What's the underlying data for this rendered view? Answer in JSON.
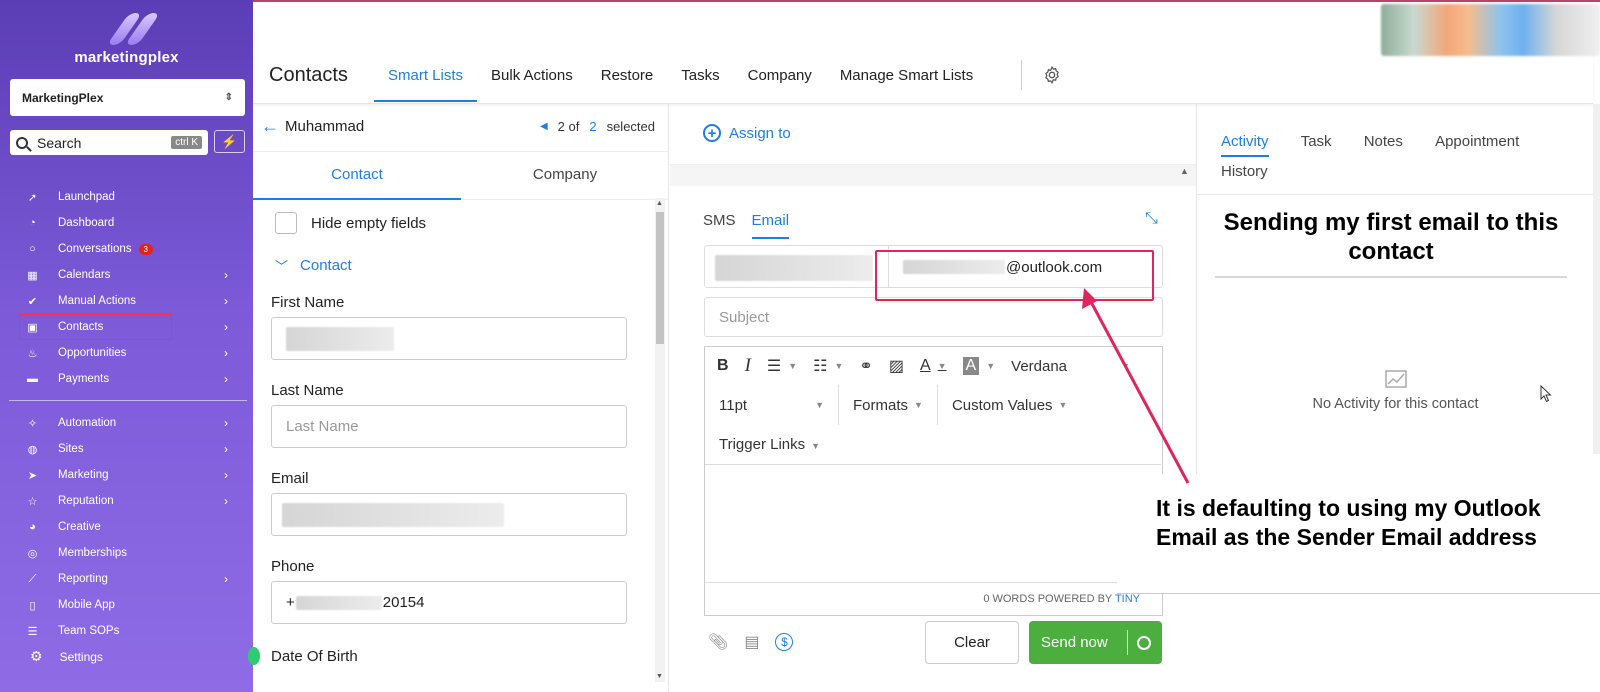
{
  "sidebar": {
    "brand": "marketingplex",
    "account": "MarketingPlex",
    "search_label": "Search",
    "search_shortcut": "ctrl K",
    "items": [
      {
        "label": "Launchpad",
        "icon": "rocket-icon",
        "has_arrow": false
      },
      {
        "label": "Dashboard",
        "icon": "gauge-icon",
        "has_arrow": false
      },
      {
        "label": "Conversations",
        "icon": "chat-icon",
        "has_arrow": false,
        "badge": "3"
      },
      {
        "label": "Calendars",
        "icon": "calendar-icon",
        "has_arrow": true
      },
      {
        "label": "Manual Actions",
        "icon": "check-icon",
        "has_arrow": true
      },
      {
        "label": "Contacts",
        "icon": "contact-card-icon",
        "has_arrow": true,
        "highlighted": true
      },
      {
        "label": "Opportunities",
        "icon": "flame-icon",
        "has_arrow": true
      },
      {
        "label": "Payments",
        "icon": "card-icon",
        "has_arrow": true
      }
    ],
    "items2": [
      {
        "label": "Automation",
        "icon": "wand-icon",
        "has_arrow": true
      },
      {
        "label": "Sites",
        "icon": "globe-icon",
        "has_arrow": true
      },
      {
        "label": "Marketing",
        "icon": "send-icon",
        "has_arrow": true
      },
      {
        "label": "Reputation",
        "icon": "star-icon",
        "has_arrow": true
      },
      {
        "label": "Creative",
        "icon": "palette-icon",
        "has_arrow": false
      },
      {
        "label": "Memberships",
        "icon": "badge-icon",
        "has_arrow": false
      },
      {
        "label": "Reporting",
        "icon": "chart-icon",
        "has_arrow": true
      },
      {
        "label": "Mobile App",
        "icon": "phone-icon",
        "has_arrow": false
      },
      {
        "label": "Team SOPs",
        "icon": "list-icon",
        "has_arrow": false
      }
    ],
    "settings": "Settings"
  },
  "header": {
    "title": "Contacts",
    "tabs": [
      "Smart Lists",
      "Bulk Actions",
      "Restore",
      "Tasks",
      "Company",
      "Manage Smart Lists"
    ]
  },
  "contact_panel": {
    "name": "Muhammad",
    "pager_current": "2 of",
    "pager_total": "2",
    "pager_suffix": "selected",
    "tabs": [
      "Contact",
      "Company"
    ],
    "hide_empty": "Hide empty fields",
    "section": "Contact",
    "first_name_label": "First Name",
    "last_name_label": "Last Name",
    "last_name_placeholder": "Last Name",
    "email_label": "Email",
    "phone_label": "Phone",
    "phone_prefix": "+",
    "phone_suffix": "20154",
    "dob_label": "Date Of Birth"
  },
  "compose": {
    "assign": "Assign to",
    "channels": [
      "SMS",
      "Email"
    ],
    "from_suffix": "@outlook.com",
    "subject_placeholder": "Subject",
    "font": "Verdana",
    "size": "11pt",
    "formats": "Formats",
    "custom_values": "Custom Values",
    "trigger_links": "Trigger Links",
    "footer_words": "0 WORDS POWERED BY",
    "footer_brand": "TINY",
    "clear": "Clear",
    "send": "Send now"
  },
  "activity": {
    "tabs": [
      "Activity",
      "Task",
      "Notes",
      "Appointment"
    ],
    "tab_history": "History",
    "empty": "No Activity for this contact"
  },
  "annotations": {
    "top": "Sending my first email to this contact",
    "bottom": "It is defaulting to using my Outlook Email as the Sender Email address",
    "color": "#e0245e"
  }
}
